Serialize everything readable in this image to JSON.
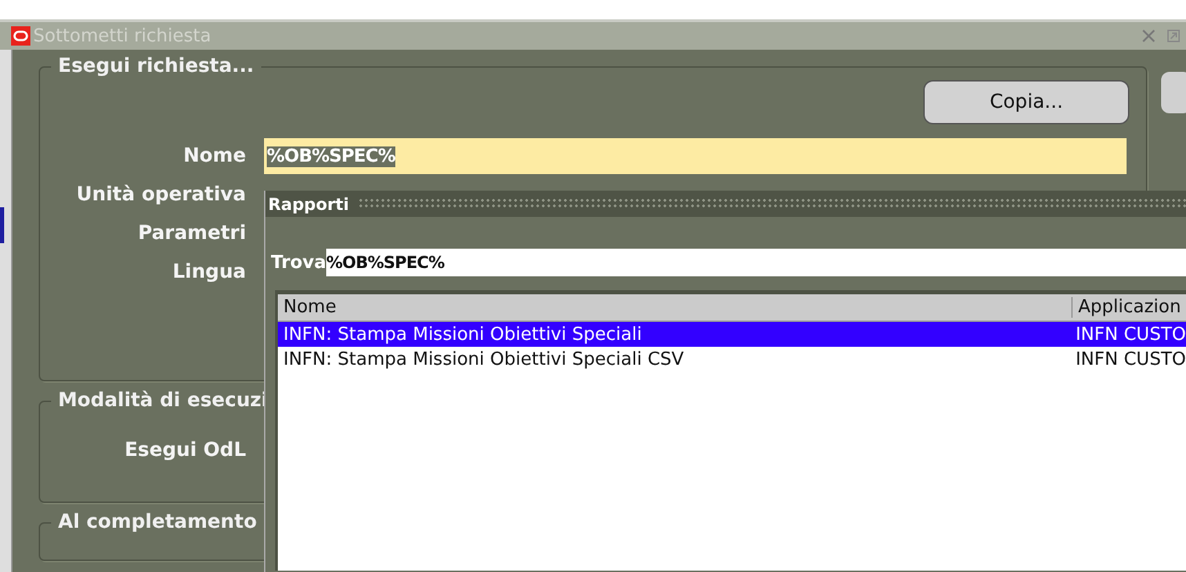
{
  "window": {
    "title": "Sottometti richiesta"
  },
  "run_group": {
    "legend": "Esegui richiesta...",
    "copy_button": "Copia...",
    "fields": [
      {
        "label": "Nome",
        "value": "%OB%SPEC%"
      },
      {
        "label": "Unità operativa"
      },
      {
        "label": "Parametri"
      },
      {
        "label": "Lingua"
      }
    ]
  },
  "schedule_group": {
    "legend": "Modalità di esecuzi",
    "fields": [
      {
        "label": "Esegui OdL"
      }
    ]
  },
  "completion_group": {
    "legend": "Al completamento"
  },
  "lov": {
    "title": "Rapporti",
    "find_label": "Trova",
    "find_value": "%OB%SPEC%",
    "columns": [
      "Nome",
      "Applicazion"
    ],
    "rows": [
      {
        "cells": [
          "INFN: Stampa Missioni Obiettivi Speciali",
          "INFN CUSTO"
        ],
        "selected": true
      },
      {
        "cells": [
          "INFN: Stampa Missioni Obiettivi Speciali CSV",
          "INFN CUSTO"
        ],
        "selected": false
      }
    ]
  }
}
